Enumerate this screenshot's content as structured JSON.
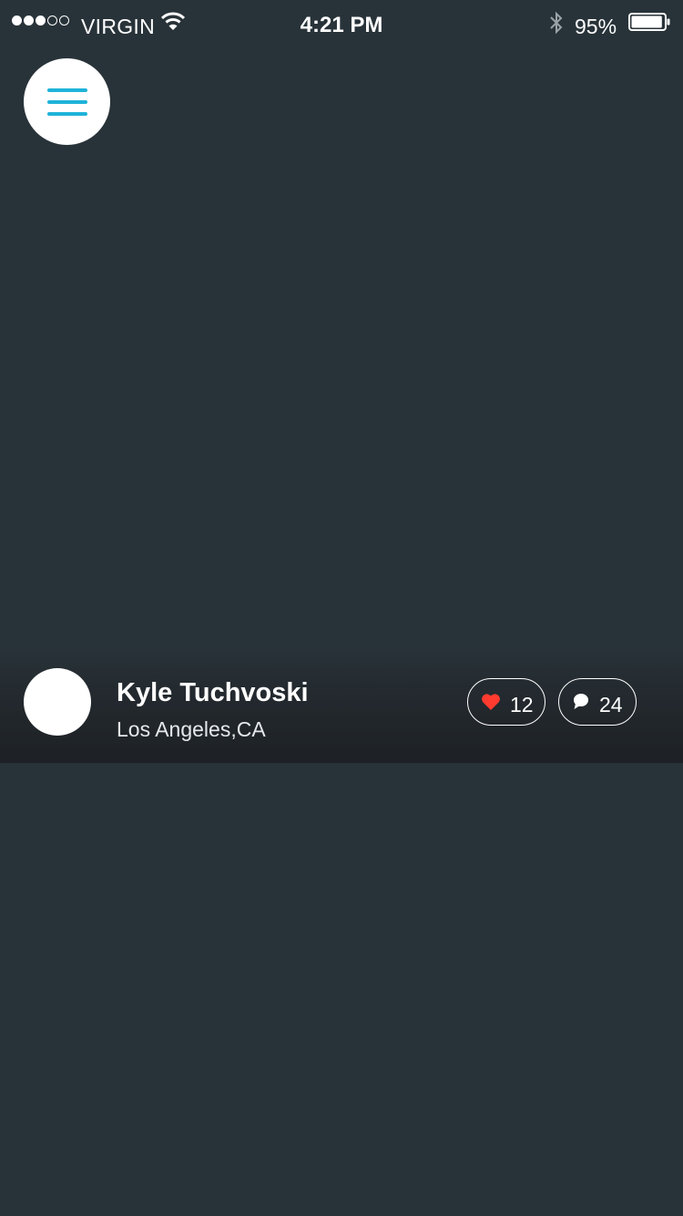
{
  "status_bar": {
    "signal_dots": [
      true,
      true,
      true,
      false,
      false
    ],
    "carrier": "VIRGIN",
    "time": "4:21 PM",
    "battery_percent": "95%",
    "battery_level": 0.95
  },
  "menu_button": {
    "icon": "hamburger-menu-icon",
    "accent": "#1fb3d9"
  },
  "profile": {
    "name": "Kyle Tuchvoski",
    "location": "Los Angeles,CA"
  },
  "stats": {
    "likes": {
      "icon": "heart-icon",
      "count": "12",
      "color": "#ff3b30"
    },
    "comments": {
      "icon": "comment-bubble-icon",
      "count": "24"
    }
  },
  "colors": {
    "background": "#283339",
    "text": "#ffffff"
  }
}
